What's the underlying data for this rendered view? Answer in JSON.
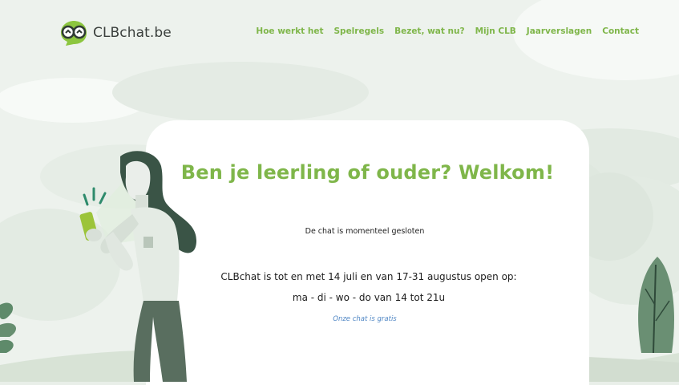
{
  "logo": {
    "text": "CLBchat.be"
  },
  "nav": {
    "items": [
      "Hoe werkt het",
      "Spelregels",
      "Bezet, wat nu?",
      "Mijn CLB",
      "Jaarverslagen",
      "Contact"
    ]
  },
  "main": {
    "headline": "Ben je leerling of ouder? Welkom!",
    "status": "De chat is momenteel gesloten",
    "hours": "CLBchat is tot en met 14 juli en van 17-31 augustus open op:",
    "days": "ma - di - wo - do van 14 tot 21u",
    "free_note": "Onze chat is gratis"
  },
  "colors": {
    "accent": "#7fb64a",
    "link": "#4f86c4"
  }
}
